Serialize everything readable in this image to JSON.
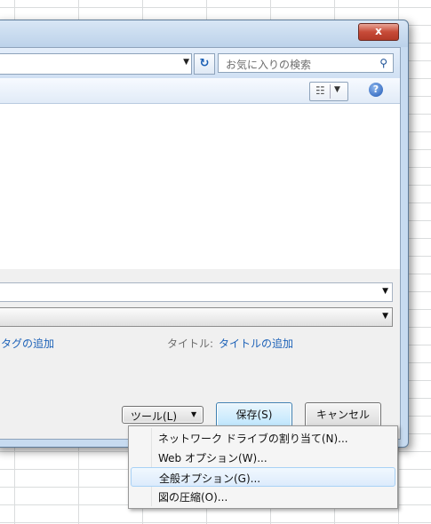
{
  "window": {
    "close_symbol": "x"
  },
  "address": {
    "dropdown_icon": "chevron-down-icon",
    "refresh_icon": "refresh-icon"
  },
  "search": {
    "placeholder": "お気に入りの検索",
    "icon": "search-icon"
  },
  "toolbar": {
    "view_icon": "view-options-icon",
    "help_symbol": "?"
  },
  "form": {
    "tags_link": "タグの追加",
    "title_label": "タイトル:",
    "title_link": "タイトルの追加"
  },
  "buttons": {
    "tools": "ツール(L)",
    "save": "保存(S)",
    "cancel": "キャンセル"
  },
  "tools_menu": {
    "items": [
      {
        "label": "ネットワーク ドライブの割り当て(N)..."
      },
      {
        "label": "Web オプション(W)..."
      },
      {
        "label": "全般オプション(G)...",
        "highlighted": true
      },
      {
        "label": "図の圧縮(O)..."
      }
    ]
  },
  "colors": {
    "link": "#1d62b8",
    "frame": "#c7dbf0",
    "close_button": "#c74b38",
    "save_button": "#bee6fd"
  }
}
